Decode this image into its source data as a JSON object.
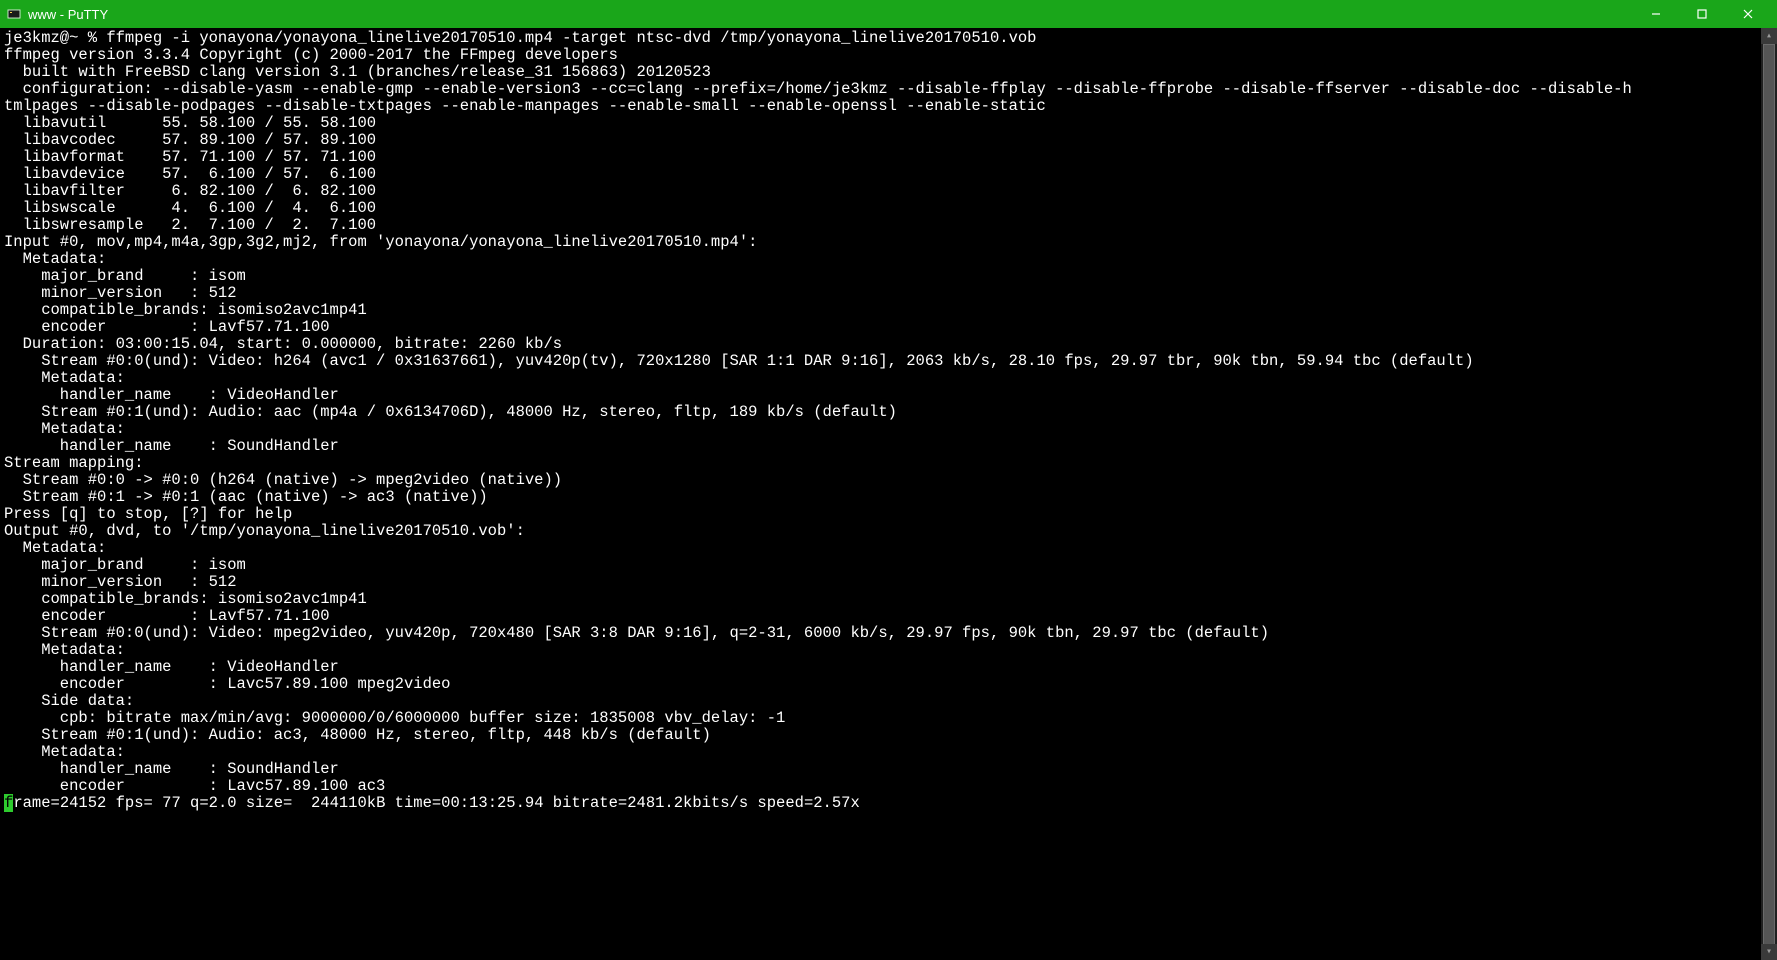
{
  "window": {
    "title": "www - PuTTY"
  },
  "terminal": {
    "lines": [
      "je3kmz@~ % ffmpeg -i yonayona/yonayona_linelive20170510.mp4 -target ntsc-dvd /tmp/yonayona_linelive20170510.vob",
      "ffmpeg version 3.3.4 Copyright (c) 2000-2017 the FFmpeg developers",
      "  built with FreeBSD clang version 3.1 (branches/release_31 156863) 20120523",
      "  configuration: --disable-yasm --enable-gmp --enable-version3 --cc=clang --prefix=/home/je3kmz --disable-ffplay --disable-ffprobe --disable-ffserver --disable-doc --disable-h",
      "tmlpages --disable-podpages --disable-txtpages --enable-manpages --enable-small --enable-openssl --enable-static",
      "  libavutil      55. 58.100 / 55. 58.100",
      "  libavcodec     57. 89.100 / 57. 89.100",
      "  libavformat    57. 71.100 / 57. 71.100",
      "  libavdevice    57.  6.100 / 57.  6.100",
      "  libavfilter     6. 82.100 /  6. 82.100",
      "  libswscale      4.  6.100 /  4.  6.100",
      "  libswresample   2.  7.100 /  2.  7.100",
      "Input #0, mov,mp4,m4a,3gp,3g2,mj2, from 'yonayona/yonayona_linelive20170510.mp4':",
      "  Metadata:",
      "    major_brand     : isom",
      "    minor_version   : 512",
      "    compatible_brands: isomiso2avc1mp41",
      "    encoder         : Lavf57.71.100",
      "  Duration: 03:00:15.04, start: 0.000000, bitrate: 2260 kb/s",
      "    Stream #0:0(und): Video: h264 (avc1 / 0x31637661), yuv420p(tv), 720x1280 [SAR 1:1 DAR 9:16], 2063 kb/s, 28.10 fps, 29.97 tbr, 90k tbn, 59.94 tbc (default)",
      "    Metadata:",
      "      handler_name    : VideoHandler",
      "    Stream #0:1(und): Audio: aac (mp4a / 0x6134706D), 48000 Hz, stereo, fltp, 189 kb/s (default)",
      "    Metadata:",
      "      handler_name    : SoundHandler",
      "Stream mapping:",
      "  Stream #0:0 -> #0:0 (h264 (native) -> mpeg2video (native))",
      "  Stream #0:1 -> #0:1 (aac (native) -> ac3 (native))",
      "Press [q] to stop, [?] for help",
      "Output #0, dvd, to '/tmp/yonayona_linelive20170510.vob':",
      "  Metadata:",
      "    major_brand     : isom",
      "    minor_version   : 512",
      "    compatible_brands: isomiso2avc1mp41",
      "    encoder         : Lavf57.71.100",
      "    Stream #0:0(und): Video: mpeg2video, yuv420p, 720x480 [SAR 3:8 DAR 9:16], q=2-31, 6000 kb/s, 29.97 fps, 90k tbn, 29.97 tbc (default)",
      "    Metadata:",
      "      handler_name    : VideoHandler",
      "      encoder         : Lavc57.89.100 mpeg2video",
      "    Side data:",
      "      cpb: bitrate max/min/avg: 9000000/0/6000000 buffer size: 1835008 vbv_delay: -1",
      "    Stream #0:1(und): Audio: ac3, 48000 Hz, stereo, fltp, 448 kb/s (default)",
      "    Metadata:",
      "      handler_name    : SoundHandler",
      "      encoder         : Lavc57.89.100 ac3"
    ],
    "status_prefix": "f",
    "status_rest": "rame=24152 fps= 77 q=2.0 size=  244110kB time=00:13:25.94 bitrate=2481.2kbits/s speed=2.57x"
  }
}
